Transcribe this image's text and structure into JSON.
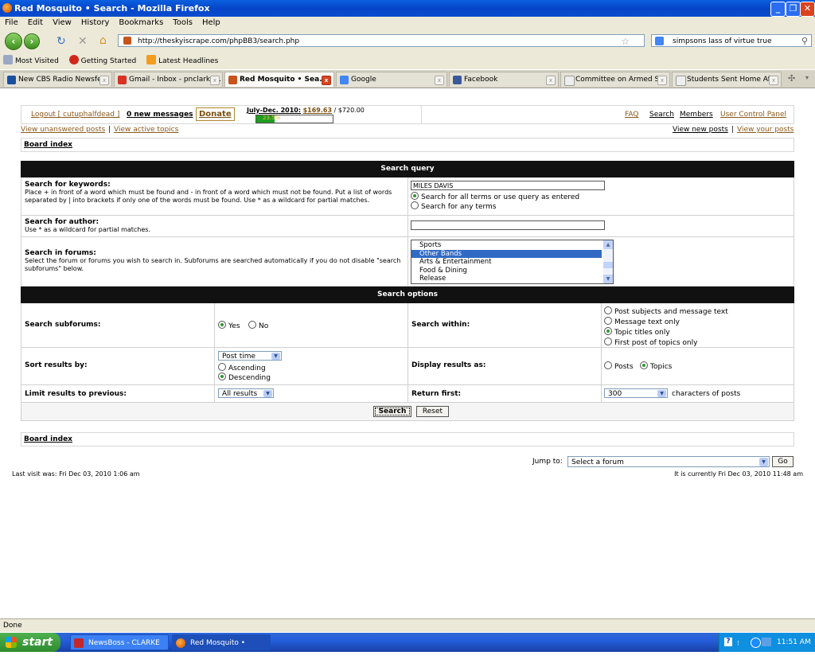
{
  "window": {
    "title": "Red Mosquito • Search - Mozilla Firefox"
  },
  "menu": [
    "File",
    "Edit",
    "View",
    "History",
    "Bookmarks",
    "Tools",
    "Help"
  ],
  "nav": {
    "url": "http://theskyiscrape.com/phpBB3/search.php",
    "search_value": "simpsons lass of virtue true"
  },
  "bookmarks": [
    "Most Visited",
    "Getting Started",
    "Latest Headlines"
  ],
  "tabs": [
    {
      "label": "New CBS Radio Newsfe...",
      "color": "#1a4fa0"
    },
    {
      "label": "Gmail - Inbox - pnclarke...",
      "color": "#d93025"
    },
    {
      "label": "Red Mosquito • Sea...",
      "color": "#c8541c"
    },
    {
      "label": "Google",
      "color": "#4285f4"
    },
    {
      "label": "Facebook",
      "color": "#3b5998"
    },
    {
      "label": "Committee on Armed S...",
      "color": "#888888"
    },
    {
      "label": "Students Sent Home Af...",
      "color": "#888888"
    }
  ],
  "topbar": {
    "logout": "Logout [ cutuphalfdead ]",
    "messages": "0 new messages",
    "donate": "Donate",
    "fund_label": "July-Dec. 2010:",
    "fund_raised": "$169.63",
    "fund_goal": "/ $720.00",
    "fund_percent": "23.5%",
    "fund_fraction": 0.235,
    "faq": "FAQ",
    "search": "Search",
    "members": "Members",
    "ucp": "User Control Panel"
  },
  "links": {
    "unanswered": "View unanswered posts",
    "active": "View active topics",
    "new_posts": "View new posts",
    "your_posts": "View your posts",
    "board_index": "Board index"
  },
  "query": {
    "header": "Search query",
    "keywords_label": "Search for keywords:",
    "keywords_help": "Place + in front of a word which must be found and - in front of a word which must not be found. Put a list of words separated by | into brackets if only one of the words must be found. Use * as a wildcard for partial matches.",
    "keywords_value": "MILES DAVIS",
    "terms_all": "Search for all terms or use query as entered",
    "terms_any": "Search for any terms",
    "author_label": "Search for author:",
    "author_help": "Use * as a wildcard for partial matches.",
    "author_value": "",
    "forums_label": "Search in forums:",
    "forums_help": "Select the forum or forums you wish to search in. Subforums are searched automatically if you do not disable \"search subforums\" below.",
    "forums": [
      "Sports",
      "Other Bands",
      "Arts & Entertainment",
      "Food & Dining",
      "Release"
    ],
    "forums_selected": "Other Bands"
  },
  "options": {
    "header": "Search options",
    "subforums_label": "Search subforums:",
    "yes": "Yes",
    "no": "No",
    "within_label": "Search within:",
    "within": [
      "Post subjects and message text",
      "Message text only",
      "Topic titles only",
      "First post of topics only"
    ],
    "within_selected": "Topic titles only",
    "sort_label": "Sort results by:",
    "sort_value": "Post time",
    "ascending": "Ascending",
    "descending": "Descending",
    "display_label": "Display results as:",
    "posts": "Posts",
    "topics": "Topics",
    "limit_label": "Limit results to previous:",
    "limit_value": "All results",
    "return_label": "Return first:",
    "return_value": "300",
    "return_suffix": "characters of posts",
    "search_button": "Search",
    "reset_button": "Reset"
  },
  "footer": {
    "jump_label": "Jump to:",
    "jump_value": "Select a forum",
    "go": "Go",
    "last_visit": "Last visit was: Fri Dec 03, 2010 1:06 am",
    "current_time": "It is currently Fri Dec 03, 2010 11:48 am"
  },
  "status": "Done",
  "taskbar": {
    "start": "start",
    "tasks": [
      "NewsBoss - CLARKE",
      "Red Mosquito • Searc..."
    ],
    "clock": "11:51 AM"
  }
}
